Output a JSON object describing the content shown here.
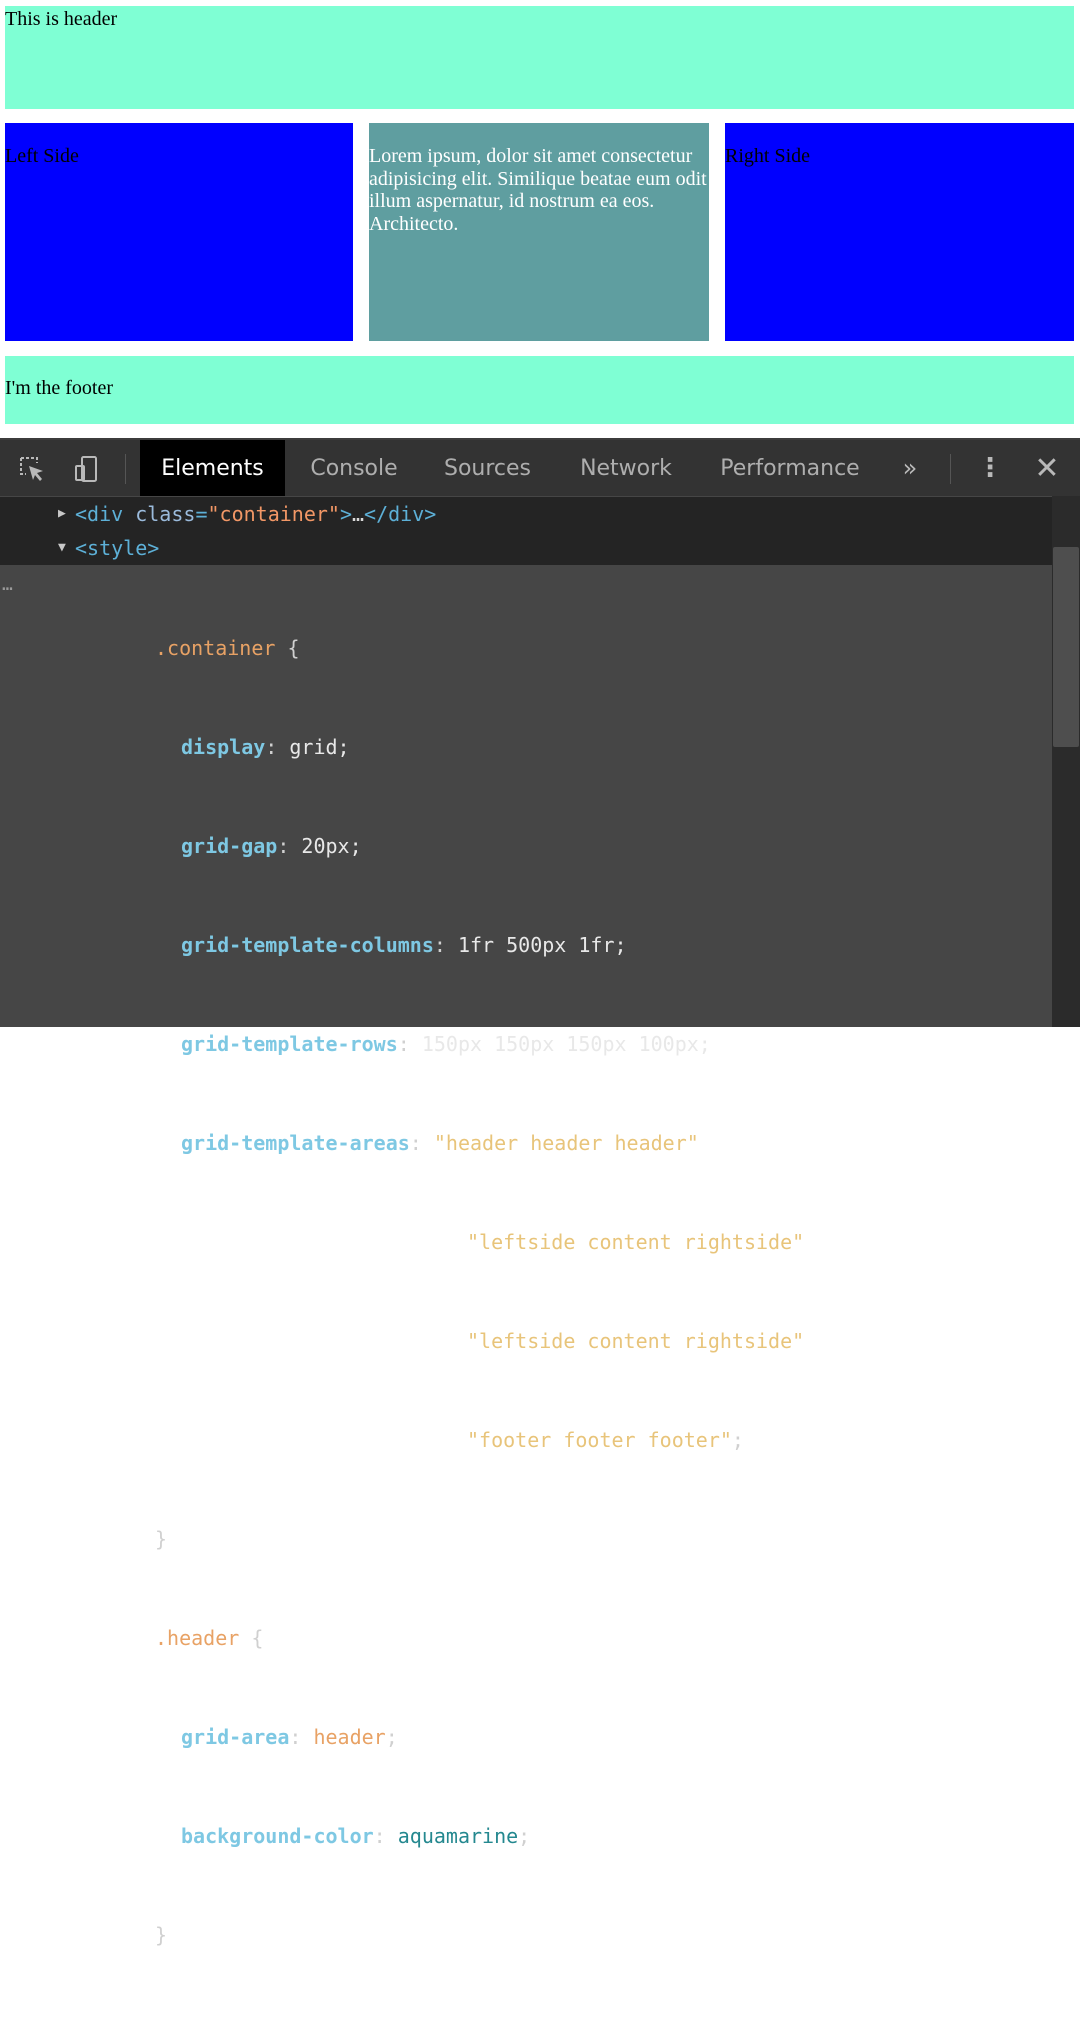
{
  "page": {
    "header_text": "This is header",
    "left_text": "Left Side",
    "content_text": "Lorem ipsum, dolor sit amet consectetur adipisicing elit. Similique beatae eum odit illum aspernatur, id nostrum ea eos. Architecto.",
    "right_text": "Right Side",
    "footer_text": "I'm the footer"
  },
  "devtools": {
    "tabs": [
      {
        "label": "Elements",
        "active": true
      },
      {
        "label": "Console",
        "active": false
      },
      {
        "label": "Sources",
        "active": false
      },
      {
        "label": "Network",
        "active": false
      },
      {
        "label": "Performance",
        "active": false
      }
    ],
    "more_tabs_label": "»",
    "kebab_label": "⋮",
    "close_label": "✕",
    "icons": [
      "inspect-element-icon",
      "device-toolbar-icon",
      "more-tabs-icon",
      "kebab-menu-icon",
      "close-icon"
    ],
    "dom": {
      "div_open": "<div",
      "div_attr": "class",
      "div_eq": "=",
      "div_val": "\"container\"",
      "div_close": ">",
      "div_ellipsis": "…",
      "div_end": "</div>",
      "style_open": "<style>",
      "gutter": "…"
    },
    "css": {
      "container_selector": ".container",
      "open_brace": "{",
      "close_brace": "}",
      "declarations": [
        {
          "prop": "display",
          "value": "grid;"
        },
        {
          "prop": "grid-gap",
          "value": "20px;"
        },
        {
          "prop": "grid-template-columns",
          "value": "1fr 500px 1fr;"
        },
        {
          "prop": "grid-template-rows",
          "value": "150px 150px 150px 100px;"
        }
      ],
      "areas_prop": "grid-template-areas",
      "areas": [
        "\"header header header\"",
        "\"leftside content rightside\"",
        "\"leftside content rightside\"",
        "\"footer footer footer\""
      ],
      "areas_end": ";",
      "header_selector": ".header",
      "header_decls": {
        "grid_area_prop": "grid-area",
        "grid_area_value": "header",
        "bg_prop": "background-color",
        "bg_value": "aquamarine"
      }
    },
    "colors": {
      "aquamarine": "#7fffd4",
      "blue": "#0000ff",
      "cadetblue": "#5f9ea0"
    }
  }
}
